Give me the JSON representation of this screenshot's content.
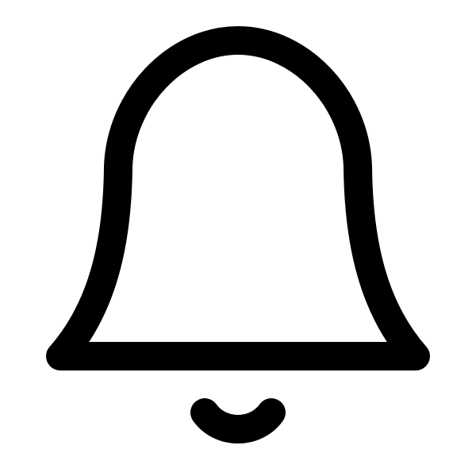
{
  "icon": {
    "name": "bell-icon",
    "stroke_color": "#000000",
    "background_color": "#ffffff"
  }
}
